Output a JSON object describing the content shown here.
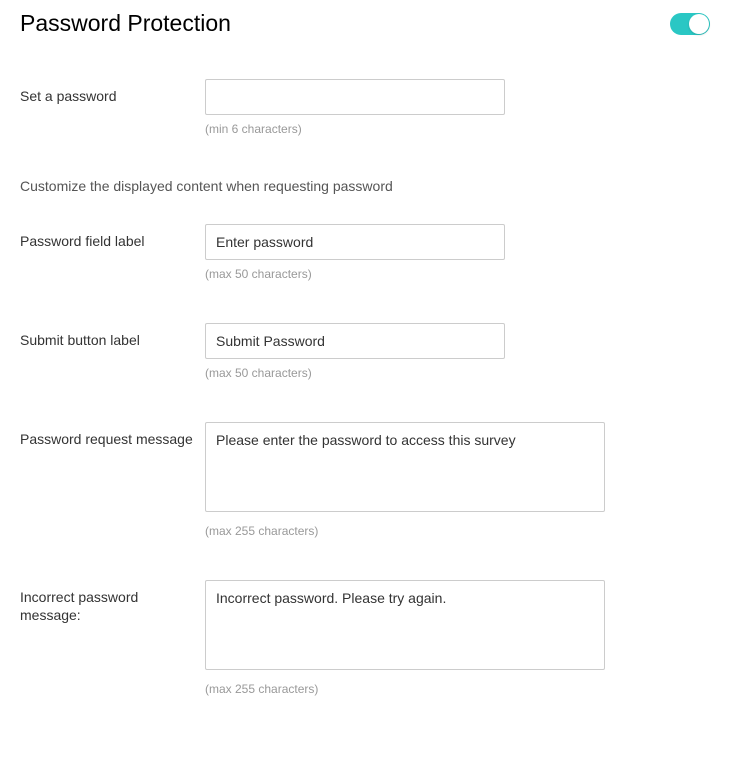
{
  "header": {
    "title": "Password Protection",
    "toggle_on": true
  },
  "section_desc": "Customize the displayed content when requesting password",
  "fields": {
    "set_password": {
      "label": "Set a password",
      "value": "",
      "hint": "(min 6 characters)"
    },
    "field_label": {
      "label": "Password field label",
      "value": "Enter password",
      "hint": "(max 50 characters)"
    },
    "submit_label": {
      "label": "Submit button label",
      "value": "Submit Password",
      "hint": "(max 50 characters)"
    },
    "request_message": {
      "label": "Password request message",
      "value": "Please enter the password to access this survey",
      "hint": "(max 255 characters)"
    },
    "incorrect_message": {
      "label": "Incorrect password message:",
      "value": "Incorrect password. Please try again.",
      "hint": "(max 255 characters)"
    }
  }
}
